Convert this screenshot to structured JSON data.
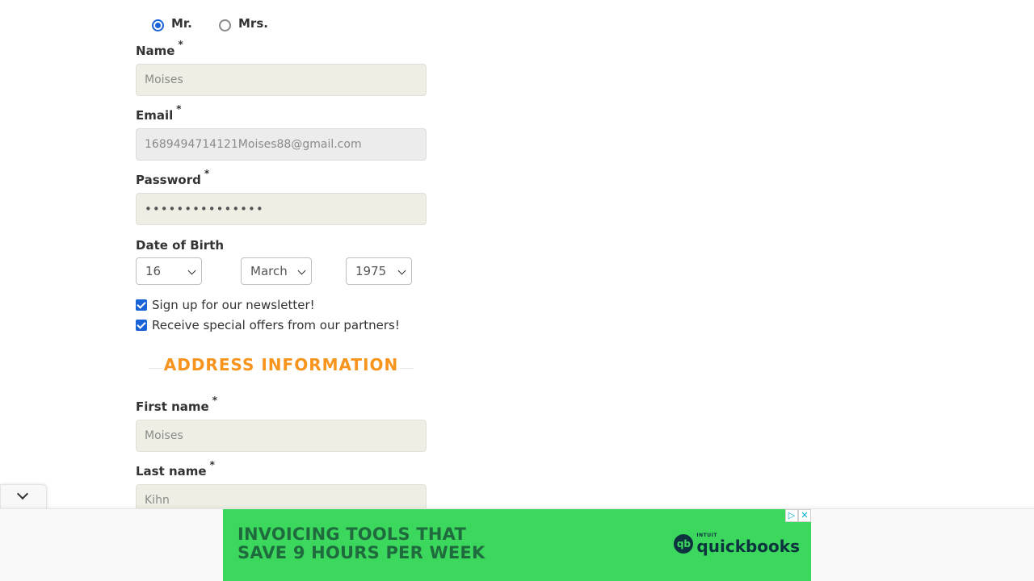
{
  "title_options": [
    {
      "label": "Mr.",
      "checked": true
    },
    {
      "label": "Mrs.",
      "checked": false
    }
  ],
  "fields": {
    "name": {
      "label": "Name",
      "required_mark": "*",
      "value": "Moises"
    },
    "email": {
      "label": "Email",
      "required_mark": "*",
      "value": "1689494714121Moises88@gmail.com"
    },
    "password": {
      "label": "Password",
      "required_mark": "*",
      "value": "•••••••••••••••"
    },
    "first_name": {
      "label": "First name",
      "required_mark": "*",
      "value": "Moises"
    },
    "last_name": {
      "label": "Last name",
      "required_mark": "*",
      "value": "Kihn"
    }
  },
  "dob": {
    "label": "Date of Birth",
    "day": "16",
    "month": "March",
    "year": "1975"
  },
  "checkboxes": [
    {
      "label": "Sign up for our newsletter!",
      "checked": true
    },
    {
      "label": "Receive special offers from our partners!",
      "checked": true
    }
  ],
  "address_section_title": "ADDRESS INFORMATION",
  "ad": {
    "headline_line1": "INVOICING TOOLS THAT",
    "headline_line2": "SAVE 9 HOURS PER WEEK",
    "logo_small": "INTUIT",
    "logo_big": "quickbooks",
    "logo_mark": "qb",
    "adchoices_icon": "▷",
    "close_icon": "✕",
    "brand_color": "#3bd85d",
    "text_color": "#1f6b3e"
  },
  "colors": {
    "accent": "#1a63d6",
    "section_title": "#f7941d",
    "input_bg": "#eeeee4"
  }
}
